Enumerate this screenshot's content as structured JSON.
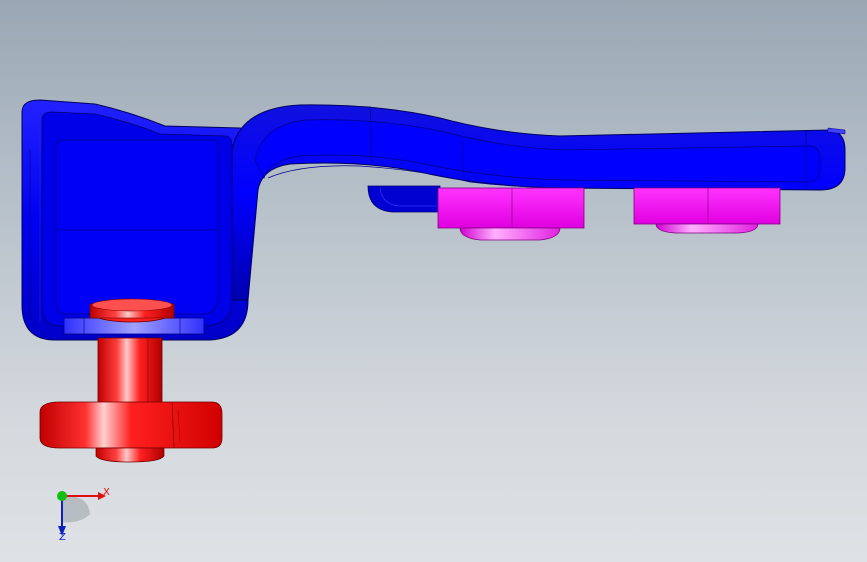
{
  "viewport": {
    "background_top": "#9aa7b4",
    "background_bottom": "#dfe2e5"
  },
  "model": {
    "bracket": {
      "color": "#0000ff",
      "shade": "#0000b8",
      "highlight": "#3a3aff"
    },
    "nuts": {
      "color": "#ff00ff",
      "shade": "#cc00cc",
      "highlight": "#ff66ff"
    },
    "bolt": {
      "color": "#ff0000",
      "shade": "#b00000",
      "highlight": "#ff7070"
    }
  },
  "triad": {
    "x_label": "X",
    "z_label": "Z",
    "x_color": "#e01010",
    "y_color": "#10c010",
    "z_color": "#1020c0",
    "icon": "coordinate-triad-icon"
  }
}
